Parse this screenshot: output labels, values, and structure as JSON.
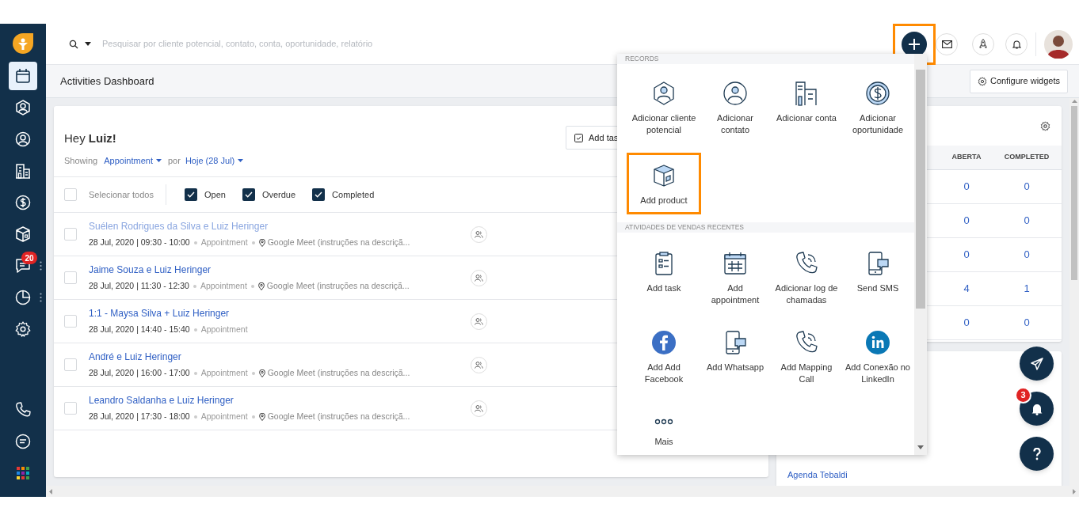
{
  "sidebar": {
    "items": [
      {
        "selected": true
      },
      {
        "selected": false
      },
      {
        "selected": false
      },
      {
        "selected": false
      },
      {
        "selected": false
      },
      {
        "selected": false
      },
      {
        "selected": false,
        "badge": "20",
        "more": true
      },
      {
        "selected": false,
        "more": true
      },
      {
        "selected": false
      }
    ],
    "bottom_items": [
      {
        "selected": false
      },
      {
        "selected": false
      },
      {
        "selected": false
      }
    ]
  },
  "topbar": {
    "search_placeholder": "Pesquisar por cliente potencial, contato, conta, oportunidade, relatório",
    "add_button": {
      "highlighted": true
    }
  },
  "page_title": "Activities Dashboard",
  "configure_button": "Configure widgets",
  "greeting": "Hey **Luiz!**",
  "filter": {
    "showing": "Showing",
    "type": "Appointment",
    "connector": "por",
    "date": "Hoje (28 Jul)"
  },
  "add_task_button": "Add tas",
  "select_all": {
    "label": "Selecionar todos",
    "checked": false
  },
  "status_filters": [
    {
      "label": "Open",
      "checked": true
    },
    {
      "label": "Overdue",
      "checked": true
    },
    {
      "label": "Completed",
      "checked": true
    }
  ],
  "activities": [
    {
      "title": "Suélen Rodrigues da Silva e Luiz Heringer",
      "checked": false,
      "faded": true,
      "when": "28 Jul, 2020 | 09:30 - 10:00",
      "type": "Appointment",
      "location": "Google Meet (instruções na descriçã..."
    },
    {
      "title": "Jaime Souza e Luiz Heringer",
      "checked": false,
      "faded": false,
      "when": "28 Jul, 2020 | 11:30 - 12:30",
      "type": "Appointment",
      "location": "Google Meet (instruções na descriçã..."
    },
    {
      "title": "1:1 - Maysa Silva + Luiz Heringer",
      "checked": false,
      "faded": false,
      "when": "28 Jul, 2020 | 14:40 - 15:40",
      "type": "Appointment"
    },
    {
      "title": "André e Luiz Heringer",
      "checked": false,
      "faded": false,
      "when": "28 Jul, 2020 | 16:00 - 17:00",
      "type": "Appointment",
      "location": "Google Meet (instruções na descriçã..."
    },
    {
      "title": "Leandro Saldanha e Luiz Heringer",
      "checked": false,
      "faded": false,
      "when": "28 Jul, 2020 | 17:30 - 18:00",
      "type": "Appointment",
      "location": "Google Meet (instruções na descriçã..."
    }
  ],
  "summary": {
    "columns": [
      "ABERTA",
      "COMPLETED"
    ],
    "rows": [
      [
        "0",
        "0"
      ],
      [
        "0",
        "0"
      ],
      [
        "0",
        "0"
      ],
      [
        "4",
        "1"
      ],
      [
        "0",
        "0"
      ]
    ]
  },
  "agenda_link": "Agenda Tebaldi",
  "notification_count": "3",
  "create_menu": {
    "sections": [
      {
        "title": "RECORDS",
        "items": [
          {
            "label": "Adicionar cliente potencial",
            "highlighted": false
          },
          {
            "label": "Adicionar contato",
            "highlighted": false
          },
          {
            "label": "Adicionar conta",
            "highlighted": false
          },
          {
            "label": "Adicionar oportunidade",
            "highlighted": false
          },
          {
            "label": "Add product",
            "highlighted": true
          }
        ]
      },
      {
        "title": "ATIVIDADES DE VENDAS RECENTES",
        "items": [
          {
            "label": "Add task",
            "highlighted": false
          },
          {
            "label": "Add appointment",
            "highlighted": false
          },
          {
            "label": "Adicionar log de chamadas",
            "highlighted": false
          },
          {
            "label": "Send SMS",
            "highlighted": false
          },
          {
            "label": "Add Add Facebook",
            "highlighted": false
          },
          {
            "label": "Add Whatsapp",
            "highlighted": false
          },
          {
            "label": "Add Mapping Call",
            "highlighted": false
          },
          {
            "label": "Add Conexão no LinkedIn",
            "highlighted": false
          },
          {
            "label": "Mais",
            "highlighted": false
          }
        ]
      }
    ]
  }
}
